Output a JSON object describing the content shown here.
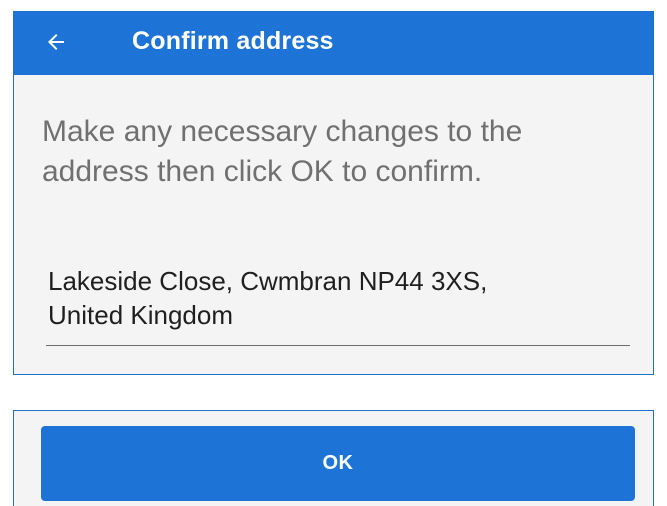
{
  "header": {
    "title": "Confirm address",
    "back_icon": "arrow-left-icon",
    "background_color": "#1e74d6"
  },
  "main": {
    "instructions": "Make any necessary changes to the address then click OK to confirm.",
    "address_value": "Lakeside Close, Cwmbran NP44 3XS,\nUnited Kingdom"
  },
  "footer": {
    "ok_label": "OK"
  },
  "colors": {
    "accent": "#1e74d6",
    "panel_background": "#f4f4f4",
    "instruction_text": "#707070"
  }
}
